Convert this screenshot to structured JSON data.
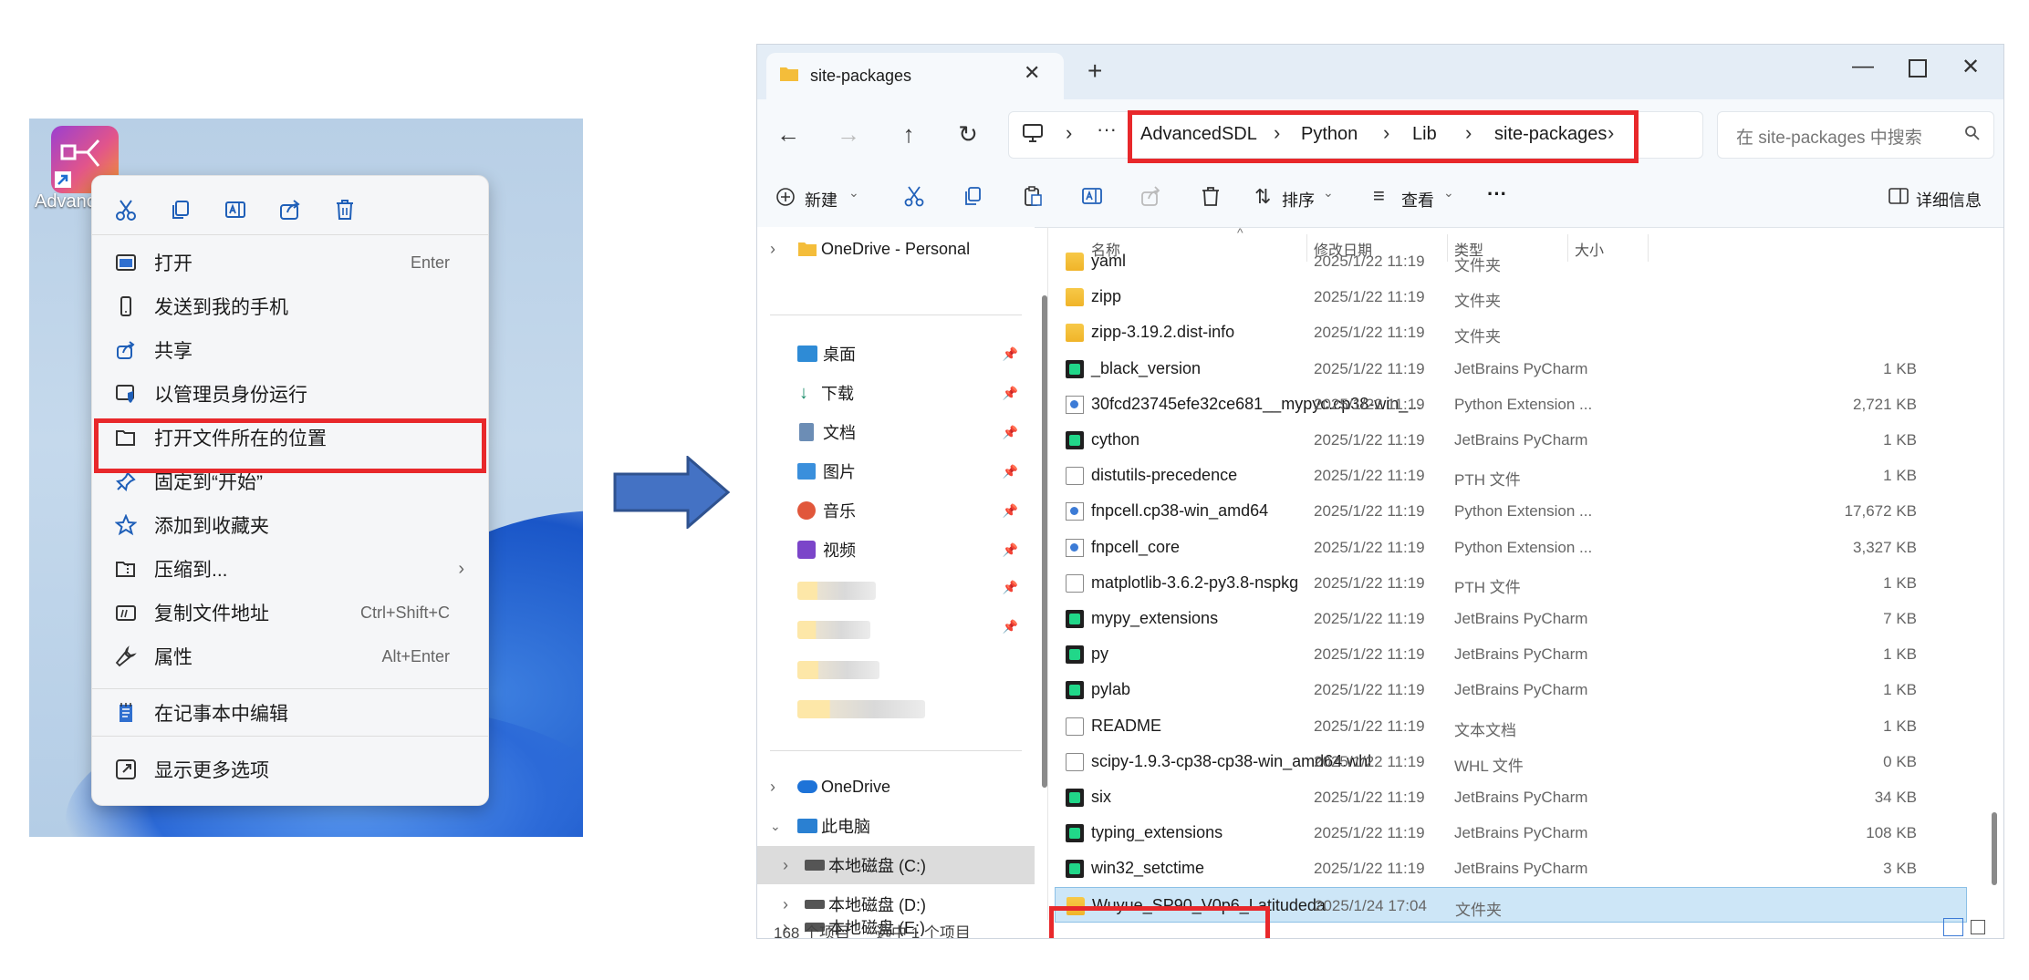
{
  "desktop": {
    "app_label": "Advanc",
    "context_menu": {
      "items": [
        {
          "label": "打开",
          "shortcut": "Enter",
          "icon": "open-icon"
        },
        {
          "label": "发送到我的手机",
          "shortcut": "",
          "icon": "phone-icon"
        },
        {
          "label": "共享",
          "shortcut": "",
          "icon": "share-icon"
        },
        {
          "label": "以管理员身份运行",
          "shortcut": "",
          "icon": "shield-icon"
        },
        {
          "label": "打开文件所在的位置",
          "shortcut": "",
          "icon": "folder-icon"
        },
        {
          "label": "固定到“开始”",
          "shortcut": "",
          "icon": "pin-icon"
        },
        {
          "label": "添加到收藏夹",
          "shortcut": "",
          "icon": "star-icon"
        },
        {
          "label": "压缩到...",
          "shortcut": "",
          "icon": "zip-icon"
        },
        {
          "label": "复制文件地址",
          "shortcut": "Ctrl+Shift+C",
          "icon": "copy-path-icon"
        },
        {
          "label": "属性",
          "shortcut": "Alt+Enter",
          "icon": "wrench-icon"
        },
        {
          "label": "在记事本中编辑",
          "shortcut": "",
          "icon": "notepad-icon"
        },
        {
          "label": "显示更多选项",
          "shortcut": "",
          "icon": "more-options-icon"
        }
      ],
      "highlighted_item": "打开文件所在的位置"
    }
  },
  "explorer": {
    "tab_title": "site-packages",
    "new_tab": "+",
    "breadcrumb": [
      "AdvancedSDL",
      "Python",
      "Lib",
      "site-packages"
    ],
    "search_placeholder": "在 site-packages 中搜索",
    "commands": {
      "new": "新建",
      "sort": "排序",
      "view": "查看",
      "more": "···",
      "details": "详细信息"
    },
    "nav": {
      "onedrive_personal": "OneDrive - Personal",
      "quick": [
        {
          "label": "桌面",
          "icon": "desktop-icon"
        },
        {
          "label": "下载",
          "icon": "download-icon"
        },
        {
          "label": "文档",
          "icon": "documents-icon"
        },
        {
          "label": "图片",
          "icon": "pictures-icon"
        },
        {
          "label": "音乐",
          "icon": "music-icon"
        },
        {
          "label": "视频",
          "icon": "video-icon"
        }
      ],
      "onedrive": "OneDrive",
      "this_pc": "此电脑",
      "drive_c": "本地磁盘 (C:)",
      "drive_d": "本地磁盘 (D:)",
      "drive_e": "本地磁盘 (E:)"
    },
    "columns": {
      "name": "名称",
      "date": "修改日期",
      "type": "类型",
      "size": "大小"
    },
    "files": [
      {
        "name": "yaml",
        "date": "2025/1/22 11:19",
        "type": "文件夹",
        "size": "",
        "icon": "folder"
      },
      {
        "name": "zipp",
        "date": "2025/1/22 11:19",
        "type": "文件夹",
        "size": "",
        "icon": "folder"
      },
      {
        "name": "zipp-3.19.2.dist-info",
        "date": "2025/1/22 11:19",
        "type": "文件夹",
        "size": "",
        "icon": "folder"
      },
      {
        "name": "_black_version",
        "date": "2025/1/22 11:19",
        "type": "JetBrains PyCharm",
        "size": "1 KB",
        "icon": "pycharm"
      },
      {
        "name": "30fcd23745efe32ce681__mypyc.cp38-win_...",
        "date": "2025/1/22 11:19",
        "type": "Python Extension ...",
        "size": "2,721 KB",
        "icon": "pyd"
      },
      {
        "name": "cython",
        "date": "2025/1/22 11:19",
        "type": "JetBrains PyCharm",
        "size": "1 KB",
        "icon": "pycharm"
      },
      {
        "name": "distutils-precedence",
        "date": "2025/1/22 11:19",
        "type": "PTH 文件",
        "size": "1 KB",
        "icon": "doc"
      },
      {
        "name": "fnpcell.cp38-win_amd64",
        "date": "2025/1/22 11:19",
        "type": "Python Extension ...",
        "size": "17,672 KB",
        "icon": "pyd"
      },
      {
        "name": "fnpcell_core",
        "date": "2025/1/22 11:19",
        "type": "Python Extension ...",
        "size": "3,327 KB",
        "icon": "pyd"
      },
      {
        "name": "matplotlib-3.6.2-py3.8-nspkg",
        "date": "2025/1/22 11:19",
        "type": "PTH 文件",
        "size": "1 KB",
        "icon": "doc"
      },
      {
        "name": "mypy_extensions",
        "date": "2025/1/22 11:19",
        "type": "JetBrains PyCharm",
        "size": "7 KB",
        "icon": "pycharm"
      },
      {
        "name": "py",
        "date": "2025/1/22 11:19",
        "type": "JetBrains PyCharm",
        "size": "1 KB",
        "icon": "pycharm"
      },
      {
        "name": "pylab",
        "date": "2025/1/22 11:19",
        "type": "JetBrains PyCharm",
        "size": "1 KB",
        "icon": "pycharm"
      },
      {
        "name": "README",
        "date": "2025/1/22 11:19",
        "type": "文本文档",
        "size": "1 KB",
        "icon": "doc"
      },
      {
        "name": "scipy-1.9.3-cp38-cp38-win_amd64.whl",
        "date": "2025/1/22 11:19",
        "type": "WHL 文件",
        "size": "0 KB",
        "icon": "doc"
      },
      {
        "name": "six",
        "date": "2025/1/22 11:19",
        "type": "JetBrains PyCharm",
        "size": "34 KB",
        "icon": "pycharm"
      },
      {
        "name": "typing_extensions",
        "date": "2025/1/22 11:19",
        "type": "JetBrains PyCharm",
        "size": "108 KB",
        "icon": "pycharm"
      },
      {
        "name": "win32_setctime",
        "date": "2025/1/22 11:19",
        "type": "JetBrains PyCharm",
        "size": "3 KB",
        "icon": "pycharm"
      },
      {
        "name": "Wuyue_SP90_V0p6_Latitudeda",
        "date": "2025/1/24 17:04",
        "type": "文件夹",
        "size": "",
        "icon": "folder"
      }
    ],
    "selected_file": "Wuyue_SP90_V0p6_Latitudeda",
    "status": {
      "count": "168 个项目",
      "selected": "选中 1 个项目"
    }
  }
}
